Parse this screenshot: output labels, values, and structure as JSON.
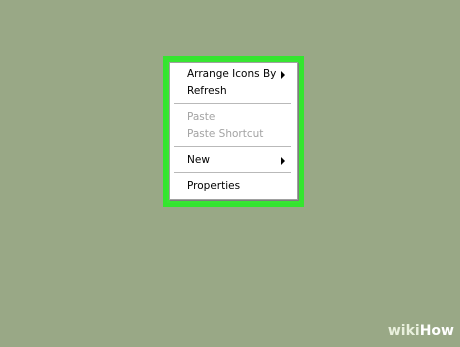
{
  "colors": {
    "desktop_background": "#99a886",
    "highlight_border": "#34e52f",
    "menu_background": "#ffffff",
    "enabled_text": "#000000",
    "disabled_text": "#a3a3a3"
  },
  "context_menu": {
    "groups": [
      {
        "items": [
          {
            "label": "Arrange Icons By",
            "enabled": true,
            "has_submenu": true,
            "icon": "chevron-right-icon"
          },
          {
            "label": "Refresh",
            "enabled": true,
            "has_submenu": false
          }
        ]
      },
      {
        "items": [
          {
            "label": "Paste",
            "enabled": false,
            "has_submenu": false
          },
          {
            "label": "Paste Shortcut",
            "enabled": false,
            "has_submenu": false
          }
        ]
      },
      {
        "items": [
          {
            "label": "New",
            "enabled": true,
            "has_submenu": true,
            "icon": "chevron-right-icon"
          }
        ]
      },
      {
        "items": [
          {
            "label": "Properties",
            "enabled": true,
            "has_submenu": false
          }
        ]
      }
    ]
  },
  "watermark": {
    "part1": "wiki",
    "part2": "How"
  }
}
